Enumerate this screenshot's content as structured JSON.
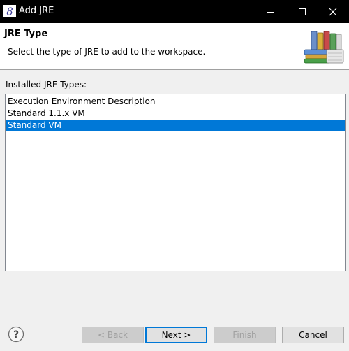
{
  "window": {
    "title": "Add JRE",
    "app_icon": "eclipse-icon"
  },
  "banner": {
    "title": "JRE Type",
    "description": "Select the type of JRE to add to the workspace.",
    "icon": "books-icon"
  },
  "content": {
    "list_label": "Installed JRE Types:",
    "items": [
      {
        "label": "Execution Environment Description",
        "selected": false
      },
      {
        "label": "Standard 1.1.x VM",
        "selected": false
      },
      {
        "label": "Standard VM",
        "selected": true
      }
    ]
  },
  "buttons": {
    "help_icon": "help-icon",
    "back": "< Back",
    "next": "Next >",
    "finish": "Finish",
    "cancel": "Cancel"
  },
  "colors": {
    "selection": "#0078d7",
    "titlebar": "#000000"
  }
}
